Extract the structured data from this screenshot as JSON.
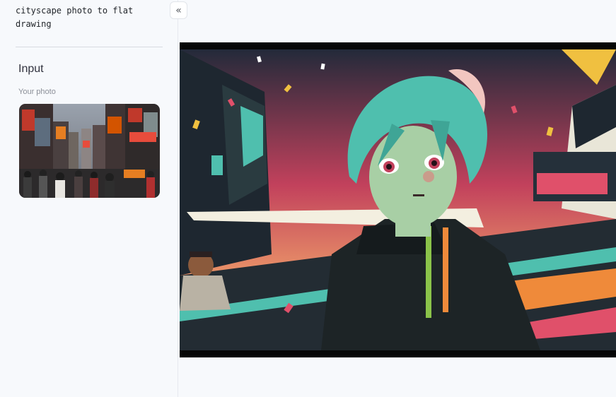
{
  "sidebar": {
    "prompt_text": "cityscape photo to flat drawing",
    "collapse_icon": "double-chevron-left",
    "section_title": "Input",
    "photo_label": "Your photo",
    "photo_subject": "busy city square with billboards and crowd"
  },
  "main": {
    "output_subject": "flat anime-style drawing of a teal-haired boy on a colorful city street"
  },
  "colors": {
    "background": "#f7f9fc",
    "hair": "#4fbfae",
    "accent_orange": "#ef8a3a",
    "accent_pink": "#e0506a",
    "jacket": "#1d2426"
  }
}
